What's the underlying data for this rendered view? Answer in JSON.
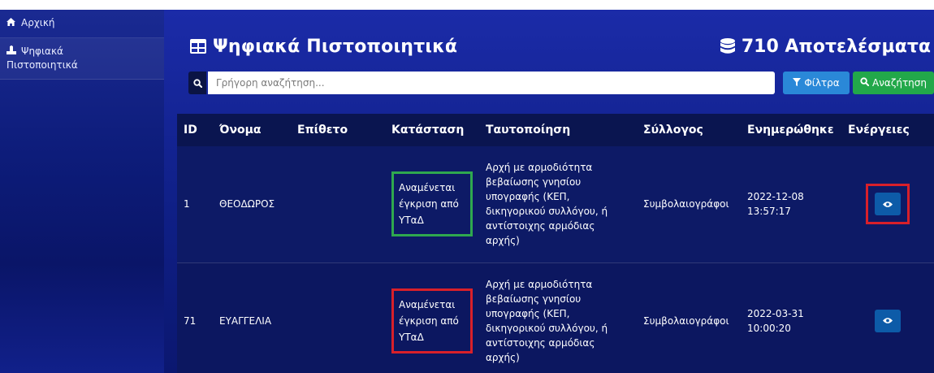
{
  "sidebar": {
    "items": [
      {
        "icon": "home-icon",
        "label": "Αρχική"
      },
      {
        "icon": "certificate-icon",
        "label_line1": "Ψηφιακά",
        "label_line2": "Πιστοποιητικά"
      }
    ]
  },
  "header": {
    "title": "Ψηφιακά Πιστοποιητικά",
    "results": "710 Αποτελέσματα"
  },
  "search": {
    "placeholder": "Γρήγορη αναζήτηση...",
    "value": ""
  },
  "buttons": {
    "filter_label": "Φίλτρα",
    "search_label": "Αναζήτηση"
  },
  "table": {
    "columns": [
      "ID",
      "Όνομα",
      "Επίθετο",
      "Κατάσταση",
      "Ταυτοποίηση",
      "Σύλλογος",
      "Ενημερώθηκε",
      "Ενέργειες"
    ],
    "rows": [
      {
        "id": "1",
        "first_name": "ΘΕΟΔΩΡΟΣ",
        "last_name": "",
        "status": "Αναμένεται έγκριση από ΥΤαΔ",
        "identification": "Αρχή με αρμοδιότητα βεβαίωσης γνησίου υπογραφής (ΚΕΠ, δικηγορικού συλλόγου, ή αντίστοιχης αρμόδιας αρχής)",
        "association": "Συμβολαιογράφοι",
        "updated_date": "2022-12-08",
        "updated_time": "13:57:17",
        "status_outline_color": "#2fa84f"
      },
      {
        "id": "71",
        "first_name": "ΕΥΑΓΓΕΛΙΑ",
        "last_name": "",
        "status": "Αναμένεται έγκριση από ΥΤαΔ",
        "identification": "Αρχή με αρμοδιότητα βεβαίωσης γνησίου υπογραφής (ΚΕΠ, δικηγορικού συλλόγου, ή αντίστοιχης αρμόδιας αρχής)",
        "association": "Συμβολαιογράφοι",
        "updated_date": "2022-03-31",
        "updated_time": "10:00:20",
        "status_outline_color": "#d8202a"
      }
    ]
  },
  "colors": {
    "sidebar_bg": "#0d1c7a",
    "main_bg": "#1b2ba8",
    "header_row_bg": "#0a1550",
    "filter_button": "#2a88d8",
    "search_button": "#22a84a",
    "view_button": "#0d5ba8",
    "highlight_red": "#d8202a",
    "highlight_green": "#2fa84f"
  }
}
